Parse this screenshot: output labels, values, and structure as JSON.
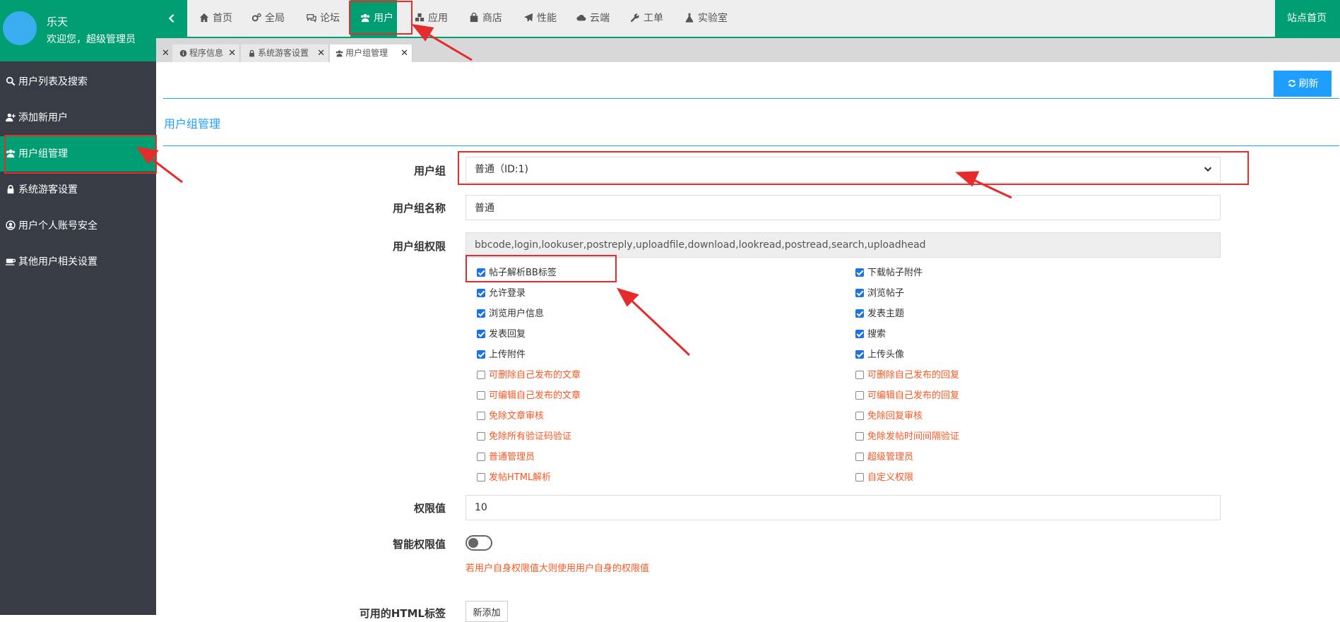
{
  "user": {
    "name": "乐天",
    "welcome": "欢迎您，超级管理员"
  },
  "sidebar": {
    "items": [
      {
        "label": "用户列表及搜索",
        "icon": "search-icon"
      },
      {
        "label": "添加新用户",
        "icon": "user-plus-icon"
      },
      {
        "label": "用户组管理",
        "icon": "users-icon",
        "active": true
      },
      {
        "label": "系统游客设置",
        "icon": "lock-icon"
      },
      {
        "label": "用户个人账号安全",
        "icon": "user-circle-icon"
      },
      {
        "label": "其他用户相关设置",
        "icon": "coffee-icon"
      }
    ]
  },
  "nav": {
    "items": [
      {
        "label": "首页",
        "icon": "home-icon"
      },
      {
        "label": "全局",
        "icon": "cogs-icon"
      },
      {
        "label": "论坛",
        "icon": "comments-icon"
      },
      {
        "label": "用户",
        "icon": "users-icon",
        "active": true
      },
      {
        "label": "应用",
        "icon": "cubes-icon"
      },
      {
        "label": "商店",
        "icon": "shopping-bag-icon"
      },
      {
        "label": "性能",
        "icon": "paper-plane-icon"
      },
      {
        "label": "云端",
        "icon": "cloud-icon"
      },
      {
        "label": "工单",
        "icon": "wrench-icon"
      },
      {
        "label": "实验室",
        "icon": "flask-icon"
      }
    ],
    "site_home": "站点首页"
  },
  "tabs": [
    {
      "label": "程序信息",
      "icon": "info-icon"
    },
    {
      "label": "系统游客设置",
      "icon": "lock-icon"
    },
    {
      "label": "用户组管理",
      "icon": "users-icon",
      "active": true
    }
  ],
  "main": {
    "refresh_label": "刷新",
    "section_title": "用户组管理",
    "form": {
      "group_label": "用户组",
      "group_value": "普通（ID:1)",
      "name_label": "用户组名称",
      "name_value": "普通",
      "perm_label": "用户组权限",
      "perm_value": "bbcode,login,lookuser,postreply,uploadfile,download,lookread,postread,search,uploadhead",
      "permissions_left": [
        {
          "label": "帖子解析BB标签",
          "checked": true
        },
        {
          "label": "允许登录",
          "checked": true
        },
        {
          "label": "浏览用户信息",
          "checked": true
        },
        {
          "label": "发表回复",
          "checked": true
        },
        {
          "label": "上传附件",
          "checked": true
        },
        {
          "label": "可删除自己发布的文章",
          "checked": false
        },
        {
          "label": "可编辑自己发布的文章",
          "checked": false
        },
        {
          "label": "免除文章审核",
          "checked": false
        },
        {
          "label": "免除所有验证码验证",
          "checked": false
        },
        {
          "label": "普通管理员",
          "checked": false
        },
        {
          "label": "发帖HTML解析",
          "checked": false
        }
      ],
      "permissions_right": [
        {
          "label": "下载帖子附件",
          "checked": true
        },
        {
          "label": "浏览帖子",
          "checked": true
        },
        {
          "label": "发表主题",
          "checked": true
        },
        {
          "label": "搜索",
          "checked": true
        },
        {
          "label": "上传头像",
          "checked": true
        },
        {
          "label": "可删除自己发布的回复",
          "checked": false
        },
        {
          "label": "可编辑自己发布的回复",
          "checked": false
        },
        {
          "label": "免除回复审核",
          "checked": false
        },
        {
          "label": "免除发帖时间间隔验证",
          "checked": false
        },
        {
          "label": "超级管理员",
          "checked": false
        },
        {
          "label": "自定义权限",
          "checked": false
        }
      ],
      "value_label": "权限值",
      "value_value": "10",
      "smart_label": "智能权限值",
      "smart_on": false,
      "smart_hint": "若用户自身权限值大则使用用户自身的权限值",
      "html_tags_label": "可用的HTML标签",
      "add_label": "新添加"
    }
  },
  "colors": {
    "primary": "#009e72",
    "accent": "#1e9fff",
    "warning": "#ff5722",
    "sidebar": "#383d45",
    "annotation": "#e52b2b"
  }
}
